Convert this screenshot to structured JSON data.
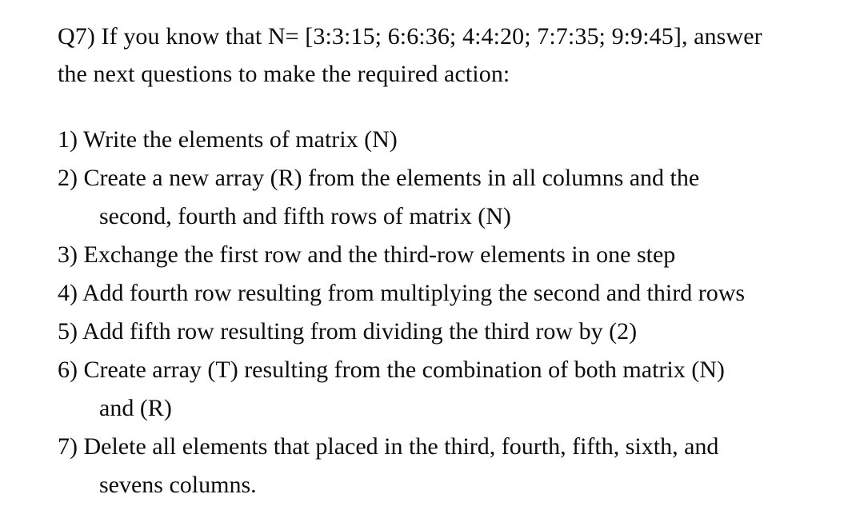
{
  "document": {
    "question_label": "Q7)",
    "prompt_lines": [
      "Q7) If you know that N= [3:3:15; 6:6:36; 4:4:20; 7:7:35; 9:9:45], answer",
      "the next questions to make the required action:"
    ],
    "matrix_expression": "N= [3:3:15; 6:6:36; 4:4:20; 7:7:35; 9:9:45]",
    "steps": [
      {
        "number": "1)",
        "lines": [
          "1) Write the elements of matrix (N)"
        ]
      },
      {
        "number": "2)",
        "lines": [
          "2) Create a new array (R) from the elements in all columns and the",
          "second, fourth and fifth rows of matrix (N)"
        ]
      },
      {
        "number": "3)",
        "lines": [
          "3) Exchange the first row and the third-row elements in one step"
        ]
      },
      {
        "number": "4)",
        "lines": [
          "4) Add fourth row resulting from multiplying the second and third rows"
        ]
      },
      {
        "number": "5)",
        "lines": [
          "5) Add fifth row resulting from dividing the third row by (2)"
        ]
      },
      {
        "number": "6)",
        "lines": [
          "6) Create array (T) resulting from the combination of both matrix (N)",
          "and (R)"
        ]
      },
      {
        "number": "7)",
        "lines": [
          "7) Delete all elements that placed in the third, fourth, fifth, sixth, and",
          "sevens columns."
        ]
      }
    ]
  }
}
